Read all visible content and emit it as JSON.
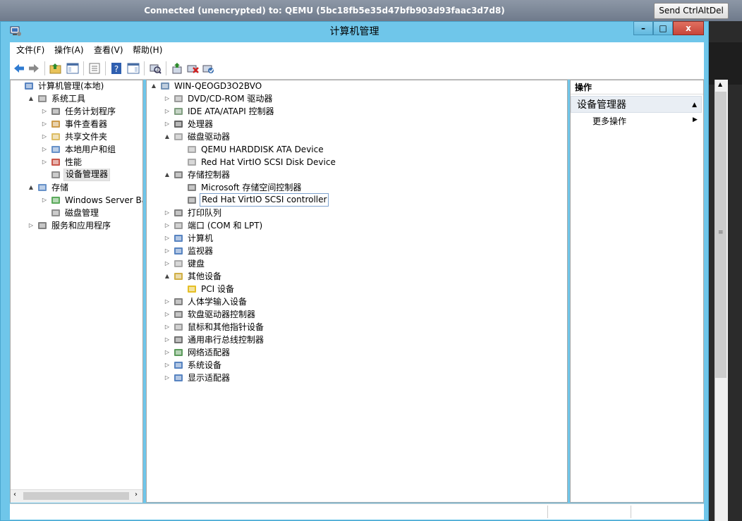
{
  "vnc": {
    "title": "Connected (unencrypted) to: QEMU (5bc18fb5e35d47bfb903d93faac3d7d8)",
    "send_button": "Send CtrlAltDel"
  },
  "window": {
    "title": "计算机管理",
    "minimize": "–",
    "maximize": "□",
    "close": "x"
  },
  "menu": [
    "文件(F)",
    "操作(A)",
    "查看(V)",
    "帮助(H)"
  ],
  "left_tree": [
    {
      "label": "计算机管理(本地)",
      "level": 0,
      "expander": "",
      "icon": "computer-management-icon",
      "color": "#3b6fb6"
    },
    {
      "label": "系统工具",
      "level": 1,
      "expander": "▲",
      "icon": "tools-icon",
      "color": "#7a7a7a"
    },
    {
      "label": "任务计划程序",
      "level": 2,
      "expander": "▷",
      "icon": "clock-icon",
      "color": "#6b6b6b"
    },
    {
      "label": "事件查看器",
      "level": 2,
      "expander": "▷",
      "icon": "event-viewer-icon",
      "color": "#c48a2c"
    },
    {
      "label": "共享文件夹",
      "level": 2,
      "expander": "▷",
      "icon": "shared-folder-icon",
      "color": "#d7b14a"
    },
    {
      "label": "本地用户和组",
      "level": 2,
      "expander": "▷",
      "icon": "users-icon",
      "color": "#4d7fbf"
    },
    {
      "label": "性能",
      "level": 2,
      "expander": "▷",
      "icon": "performance-icon",
      "color": "#c0392b"
    },
    {
      "label": "设备管理器",
      "level": 2,
      "expander": "",
      "icon": "device-manager-icon",
      "color": "#7a7a7a",
      "selected": true
    },
    {
      "label": "存储",
      "level": 1,
      "expander": "▲",
      "icon": "storage-icon",
      "color": "#4d7fbf"
    },
    {
      "label": "Windows Server Back",
      "level": 2,
      "expander": "▷",
      "icon": "backup-icon",
      "color": "#3f9b3f"
    },
    {
      "label": "磁盘管理",
      "level": 2,
      "expander": "",
      "icon": "disk-management-icon",
      "color": "#7a7a7a"
    },
    {
      "label": "服务和应用程序",
      "level": 1,
      "expander": "▷",
      "icon": "services-icon",
      "color": "#6b6b6b"
    }
  ],
  "device_tree": [
    {
      "label": "WIN-QEOGD3O2BVO",
      "level": 0,
      "expander": "▲",
      "icon": "computer-icon",
      "color": "#5a7fa8"
    },
    {
      "label": "DVD/CD-ROM 驱动器",
      "level": 1,
      "expander": "▷",
      "icon": "dvd-drive-icon",
      "color": "#8a8a8a"
    },
    {
      "label": "IDE ATA/ATAPI 控制器",
      "level": 1,
      "expander": "▷",
      "icon": "ide-controller-icon",
      "color": "#6b8e6b"
    },
    {
      "label": "处理器",
      "level": 1,
      "expander": "▷",
      "icon": "processor-icon",
      "color": "#4a4a4a"
    },
    {
      "label": "磁盘驱动器",
      "level": 1,
      "expander": "▲",
      "icon": "disk-drive-icon",
      "color": "#9a9a9a"
    },
    {
      "label": "QEMU HARDDISK ATA Device",
      "level": 2,
      "expander": "",
      "icon": "hard-disk-icon",
      "color": "#9a9a9a"
    },
    {
      "label": "Red Hat VirtIO SCSI Disk Device",
      "level": 2,
      "expander": "",
      "icon": "hard-disk-icon",
      "color": "#9a9a9a"
    },
    {
      "label": "存储控制器",
      "level": 1,
      "expander": "▲",
      "icon": "storage-controller-icon",
      "color": "#6b6b6b"
    },
    {
      "label": "Microsoft 存储空间控制器",
      "level": 2,
      "expander": "",
      "icon": "storage-controller-icon",
      "color": "#6b6b6b"
    },
    {
      "label": "Red Hat VirtIO SCSI controller",
      "level": 2,
      "expander": "",
      "icon": "storage-controller-icon",
      "color": "#6b6b6b",
      "selected": true
    },
    {
      "label": "打印队列",
      "level": 1,
      "expander": "▷",
      "icon": "printer-icon",
      "color": "#6b6b6b"
    },
    {
      "label": "端口 (COM 和 LPT)",
      "level": 1,
      "expander": "▷",
      "icon": "port-icon",
      "color": "#8a8a8a"
    },
    {
      "label": "计算机",
      "level": 1,
      "expander": "▷",
      "icon": "computer-icon",
      "color": "#3b6fb6"
    },
    {
      "label": "监视器",
      "level": 1,
      "expander": "▷",
      "icon": "monitor-icon",
      "color": "#3b6fb6"
    },
    {
      "label": "键盘",
      "level": 1,
      "expander": "▷",
      "icon": "keyboard-icon",
      "color": "#9a9a9a"
    },
    {
      "label": "其他设备",
      "level": 1,
      "expander": "▲",
      "icon": "unknown-device-icon",
      "color": "#c9a227"
    },
    {
      "label": "PCI 设备",
      "level": 2,
      "expander": "",
      "icon": "warning-device-icon",
      "color": "#e0b400"
    },
    {
      "label": "人体学输入设备",
      "level": 1,
      "expander": "▷",
      "icon": "hid-icon",
      "color": "#6b6b6b"
    },
    {
      "label": "软盘驱动器控制器",
      "level": 1,
      "expander": "▷",
      "icon": "floppy-controller-icon",
      "color": "#6b6b6b"
    },
    {
      "label": "鼠标和其他指针设备",
      "level": 1,
      "expander": "▷",
      "icon": "mouse-icon",
      "color": "#8a8a8a"
    },
    {
      "label": "通用串行总线控制器",
      "level": 1,
      "expander": "▷",
      "icon": "usb-icon",
      "color": "#5a5a5a"
    },
    {
      "label": "网络适配器",
      "level": 1,
      "expander": "▷",
      "icon": "network-adapter-icon",
      "color": "#3f8a3f"
    },
    {
      "label": "系统设备",
      "level": 1,
      "expander": "▷",
      "icon": "system-device-icon",
      "color": "#3b6fb6"
    },
    {
      "label": "显示适配器",
      "level": 1,
      "expander": "▷",
      "icon": "display-adapter-icon",
      "color": "#3b6fb6"
    }
  ],
  "actions": {
    "header": "操作",
    "section": "设备管理器",
    "more": "更多操作"
  },
  "colors": {
    "window_frame": "#6fc6ea",
    "close_button": "#c7453a",
    "selection": "#7da2ce"
  }
}
